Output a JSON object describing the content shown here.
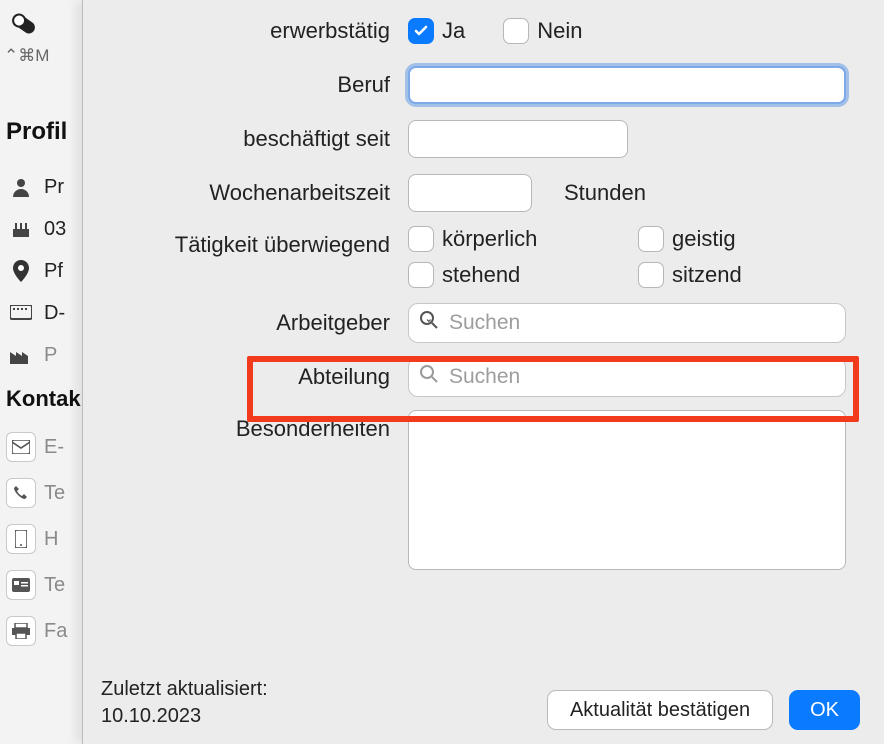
{
  "toolbar": {
    "shortcut": "⌃⌘M"
  },
  "sidebar": {
    "section_profile": "Profil",
    "section_contact": "Kontak",
    "rows": {
      "person": "Pr",
      "date": "03",
      "location": "Pf",
      "keyboard": "D-",
      "factory": "P",
      "email": "E-",
      "phone": "Te",
      "mobile": "H",
      "card": "Te",
      "fax": "Fa"
    }
  },
  "form": {
    "employed_label": "erwerbstätig",
    "yes": "Ja",
    "no": "Nein",
    "profession_label": "Beruf",
    "profession_value": "",
    "employed_since_label": "beschäftigt seit",
    "employed_since_value": "",
    "weekly_hours_label": "Wochenarbeitszeit",
    "weekly_hours_value": "",
    "hours_unit": "Stunden",
    "activity_label": "Tätigkeit überwiegend",
    "activity_physical": "körperlich",
    "activity_mental": "geistig",
    "activity_standing": "stehend",
    "activity_sitting": "sitzend",
    "employer_label": "Arbeitgeber",
    "employer_placeholder": "Suchen",
    "department_label": "Abteilung",
    "department_placeholder": "Suchen",
    "notes_label": "Besonderheiten",
    "notes_value": ""
  },
  "footer": {
    "updated_label": "Zuletzt aktualisiert:",
    "updated_date": "10.10.2023",
    "confirm": "Aktualität bestätigen",
    "ok": "OK"
  }
}
